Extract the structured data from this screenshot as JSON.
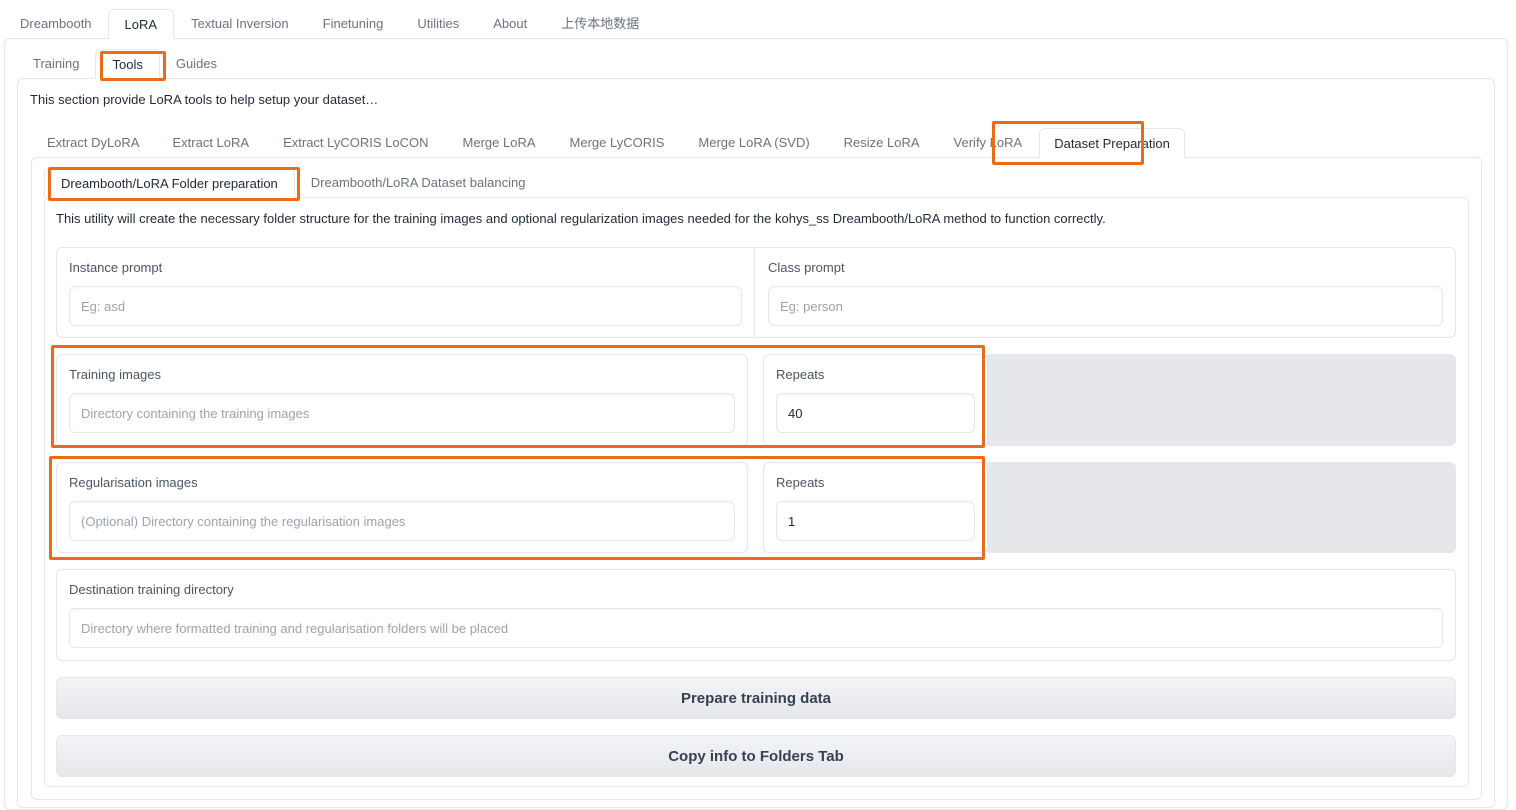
{
  "top_tabs": [
    "Dreambooth",
    "LoRA",
    "Textual Inversion",
    "Finetuning",
    "Utilities",
    "About",
    "上传本地数据"
  ],
  "lora_tabs": [
    "Training",
    "Tools",
    "Guides"
  ],
  "tools_description": "This section provide LoRA tools to help setup your dataset…",
  "tool_tabs": [
    "Extract DyLoRA",
    "Extract LoRA",
    "Extract LyCORIS LoCON",
    "Merge LoRA",
    "Merge LyCORIS",
    "Merge LoRA (SVD)",
    "Resize LoRA",
    "Verify LoRA",
    "Dataset Preparation"
  ],
  "dataset_tabs": [
    "Dreambooth/LoRA Folder preparation",
    "Dreambooth/LoRA Dataset balancing"
  ],
  "utility_description": "This utility will create the necessary folder structure for the training images and optional regularization images needed for the kohys_ss Dreambooth/LoRA method to function correctly.",
  "fields": {
    "instance_prompt": {
      "label": "Instance prompt",
      "placeholder": "Eg: asd",
      "value": ""
    },
    "class_prompt": {
      "label": "Class prompt",
      "placeholder": "Eg: person",
      "value": ""
    },
    "training_images": {
      "label": "Training images",
      "placeholder": "Directory containing the training images",
      "value": ""
    },
    "training_repeats": {
      "label": "Repeats",
      "value": "40"
    },
    "reg_images": {
      "label": "Regularisation images",
      "placeholder": "(Optional) Directory containing the regularisation images",
      "value": ""
    },
    "reg_repeats": {
      "label": "Repeats",
      "value": "1"
    },
    "destination": {
      "label": "Destination training directory",
      "placeholder": "Directory where formatted training and regularisation folders will be placed",
      "value": ""
    }
  },
  "buttons": {
    "prepare": "Prepare training data",
    "copy_info": "Copy info to Folders Tab"
  },
  "colors": {
    "highlight": "#ea6c16",
    "border": "#e5e7eb",
    "muted_text": "#6b7280"
  }
}
